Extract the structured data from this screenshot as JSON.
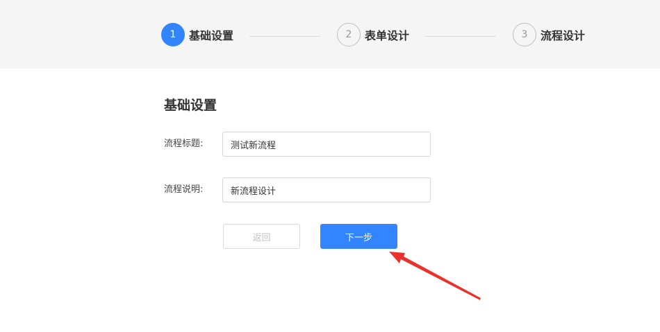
{
  "steps": [
    {
      "number": "1",
      "label": "基础设置",
      "state": "active"
    },
    {
      "number": "2",
      "label": "表单设计",
      "state": "inactive"
    },
    {
      "number": "3",
      "label": "流程设计",
      "state": "inactive"
    }
  ],
  "form": {
    "section_title": "基础设置",
    "title_label": "流程标题:",
    "title_value": "测试新流程",
    "desc_label": "流程说明:",
    "desc_value": "新流程设计"
  },
  "buttons": {
    "back_label": "返回",
    "next_label": "下一步"
  },
  "colors": {
    "primary": "#3385ff",
    "annotation_arrow": "#e8322b"
  }
}
